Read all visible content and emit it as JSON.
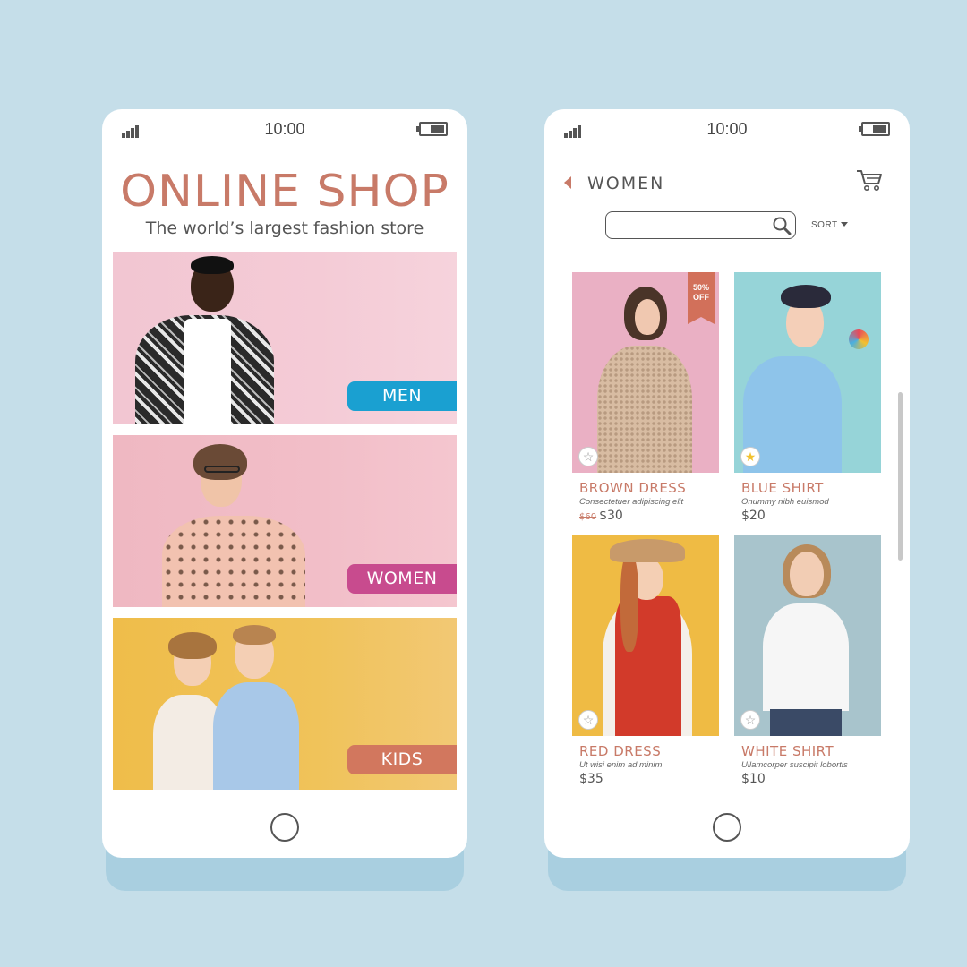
{
  "colors": {
    "background": "#c5dee9",
    "accent": "#c87a68",
    "men": "#1aa0d1",
    "women": "#c84b8e",
    "kids": "#d2775e"
  },
  "left_phone": {
    "status": {
      "time": "10:00"
    },
    "title": "ONLINE SHOP",
    "subtitle": "The world’s largest fashion store",
    "categories": [
      {
        "label": "MEN",
        "color": "#1aa0d1"
      },
      {
        "label": "WOMEN",
        "color": "#c84b8e"
      },
      {
        "label": "KIDS",
        "color": "#d2775e"
      }
    ]
  },
  "right_phone": {
    "status": {
      "time": "10:00"
    },
    "page_title": "WOMEN",
    "search": {
      "value": ""
    },
    "sort_label": "SORT",
    "products": [
      {
        "name": "BROWN DRESS",
        "desc": "Consectetuer adipiscing elit",
        "old_price": "$60",
        "price": "$30",
        "badge_line1": "50%",
        "badge_line2": "OFF",
        "favorite": "☆"
      },
      {
        "name": "BLUE SHIRT",
        "desc": "Onummy nibh euismod",
        "price": "$20",
        "favorite": "★"
      },
      {
        "name": "RED DRESS",
        "desc": "Ut wisi enim ad minim",
        "price": "$35",
        "favorite": "☆"
      },
      {
        "name": "WHITE SHIRT",
        "desc": "Ullamcorper suscipit lobortis",
        "price": "$10",
        "favorite": "☆"
      }
    ]
  }
}
